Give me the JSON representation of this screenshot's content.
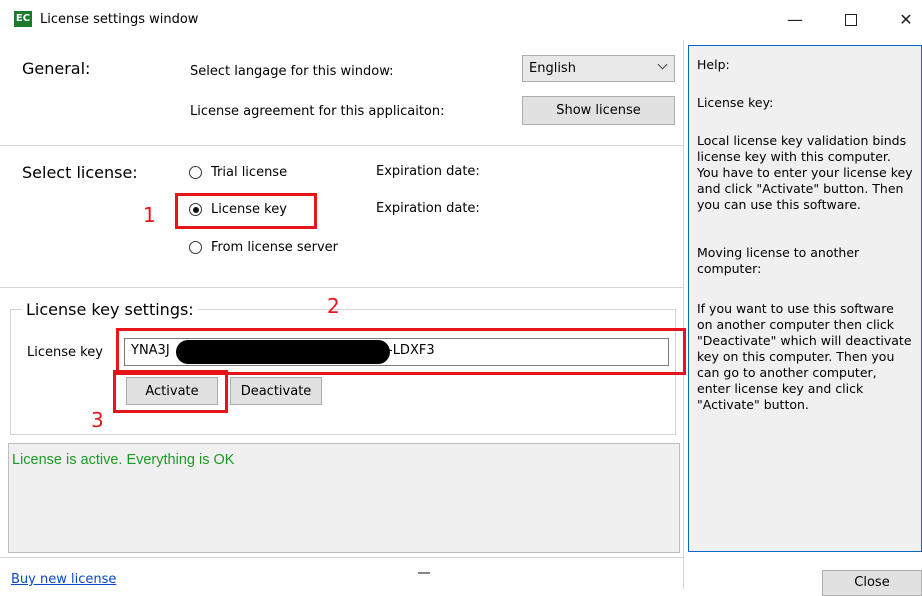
{
  "window": {
    "icon_text": "EC",
    "title": "License settings window",
    "min_glyph": "—",
    "close_glyph": "✕"
  },
  "general": {
    "title": "General:",
    "language_label": "Select langage for this window:",
    "language_value": "English",
    "agreement_label": "License agreement for this applicaiton:",
    "show_license_label": "Show license"
  },
  "select_license": {
    "title": "Select license:",
    "options": [
      {
        "label": "Trial license",
        "selected": false
      },
      {
        "label": "License key",
        "selected": true
      },
      {
        "label": "From license server",
        "selected": false
      }
    ],
    "expiration_label_1": "Expiration date:",
    "expiration_label_2": "Expiration date:"
  },
  "key_settings": {
    "title": "License key settings:",
    "key_label": "License key",
    "key_value_start": "YNA3J",
    "key_value_end": "-LDXF3",
    "activate_label": "Activate",
    "deactivate_label": "Deactivate"
  },
  "annotations": {
    "n1": "1",
    "n2": "2",
    "n3": "3",
    "color": "#e8141c"
  },
  "status": {
    "text": "License is active. Everything is OK",
    "color": "#1a9a23"
  },
  "help": {
    "title": "Help:",
    "subtitle": "License key:",
    "para1": "Local license key validation binds\nlicense key with this computer.\nYou have to enter your license key\nand click \"Activate\" button. Then\nyou can use this software.",
    "para2_title": "Moving license to another\ncomputer:",
    "para3": "If you want to use this software\non another computer then click\n\"Deactivate\" which will deactivate\nkey on this computer. Then you\ncan go to another computer,\nenter license key and click\n\"Activate\" button.",
    "border_color": "#0a64c8"
  },
  "footer": {
    "buy_link": "Buy new license",
    "close_label": "Close"
  }
}
